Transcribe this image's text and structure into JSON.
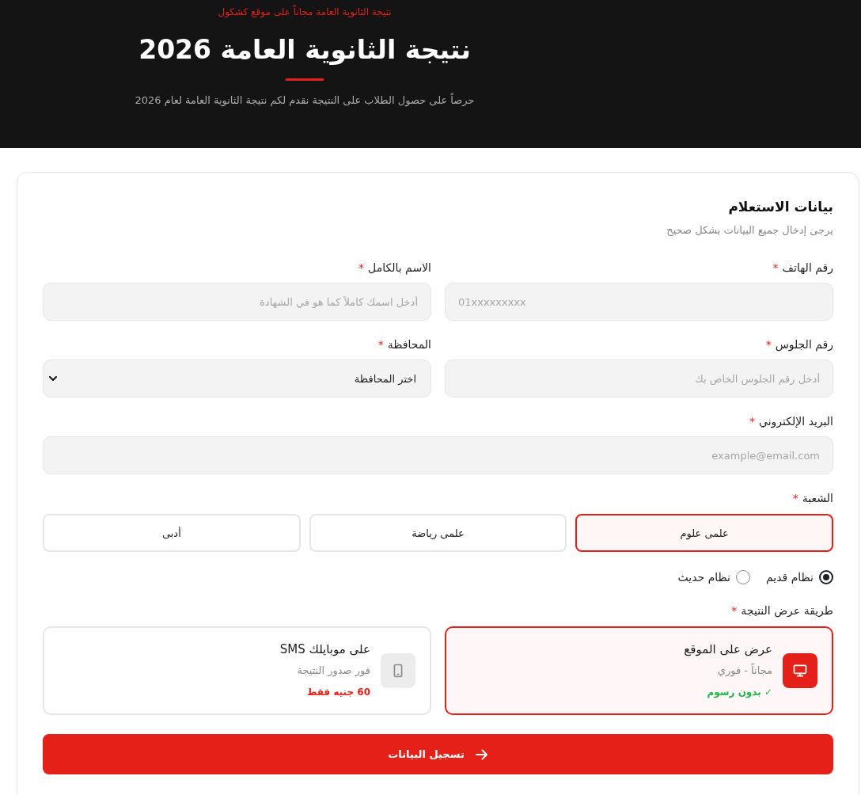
{
  "header": {
    "tagline": "نتيجة الثانوية العامة مجاناً على موقع كشكول",
    "title": "نتيجة الثانوية العامة 2026",
    "subtitle": "حرصاً على حصول الطلاب على النتيجة نقدم لكم نتيجة الثانوية العامة لعام 2026"
  },
  "form": {
    "title": "بيانات الاستعلام",
    "subtitle": "يرجى إدخال جميع البيانات بشكل صحيح",
    "rows": [
      [
        {
          "kind": "tel",
          "label": "رقم الهاتف",
          "required_mark": "*",
          "placeholder": "01xxxxxxxxx"
        },
        {
          "kind": "text",
          "label": "الاسم بالكامل",
          "required_mark": "*",
          "placeholder": "أدخل اسمك كاملاً كما هو في الشهادة"
        }
      ],
      [
        {
          "kind": "text",
          "label": "رقم الجلوس",
          "required_mark": "*",
          "placeholder": "أدخل رقم الجلوس الخاص بك"
        },
        {
          "kind": "select",
          "label": "المحافظة",
          "required_mark": "*",
          "value": "اختر المحافظة"
        }
      ],
      [
        {
          "kind": "email",
          "label": "البريد الإلكتروني",
          "required_mark": "*",
          "placeholder": "example@email.com"
        }
      ]
    ],
    "branch": {
      "label": "الشعبة",
      "required_mark": "*",
      "options": [
        {
          "label": "علمى علوم",
          "selected": true
        },
        {
          "label": "علمى رياضة",
          "selected": false
        },
        {
          "label": "أدبى",
          "selected": false
        }
      ]
    },
    "system": {
      "options": [
        {
          "label": "نظام قديم",
          "selected": true
        },
        {
          "label": "نظام حديث",
          "selected": false
        }
      ]
    },
    "result_method": {
      "label": "طريقة عرض النتيجة",
      "required_mark": "*",
      "options": [
        {
          "kind": "web",
          "title": "عرض على الموقع",
          "subtitle": "مجاناً - فوري",
          "note": "✓ بدون رسوم",
          "selected": true
        },
        {
          "kind": "sms",
          "title": "على موبايلك SMS",
          "subtitle": "فور صدور النتيجة",
          "note": "60 جنيه فقط",
          "selected": false
        }
      ]
    },
    "submit": {
      "label": "تسجيل البيانات"
    }
  }
}
